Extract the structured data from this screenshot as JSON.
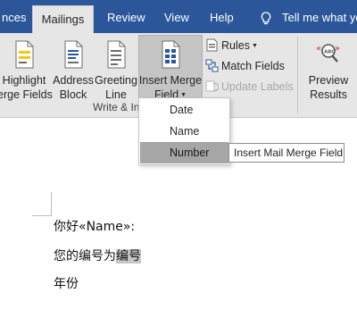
{
  "tabs": {
    "references_partial": "nces",
    "mailings": "Mailings",
    "review": "Review",
    "view": "View",
    "help": "Help",
    "tell_me": "Tell me what yo"
  },
  "ribbon": {
    "highlight_line1": "Highlight",
    "highlight_line2": "erge Fields",
    "address_line1": "Address",
    "address_line2": "Block",
    "greeting_line1": "Greeting",
    "greeting_line2": "Line",
    "insert_line1": "Insert Merge",
    "insert_line2": "Field",
    "rules": "Rules",
    "match_fields": "Match Fields",
    "update_labels": "Update Labels",
    "preview_line1": "Preview",
    "preview_line2": "Results",
    "group_label": "Write & In"
  },
  "dropdown": {
    "items": [
      "Date",
      "Name",
      "Number"
    ],
    "tooltip": "Insert Mail Merge Field"
  },
  "document": {
    "line1": "你好«Name»:",
    "line2_prefix": "您的编号为",
    "line2_field": "编号",
    "line3": "年份"
  },
  "colors": {
    "title_bar": "#2b579a",
    "ribbon_bg": "#e6e6e6",
    "selected_button": "#c5c5c5",
    "hover_item": "#a6a6a6",
    "field_shading": "#c6c6c6"
  }
}
